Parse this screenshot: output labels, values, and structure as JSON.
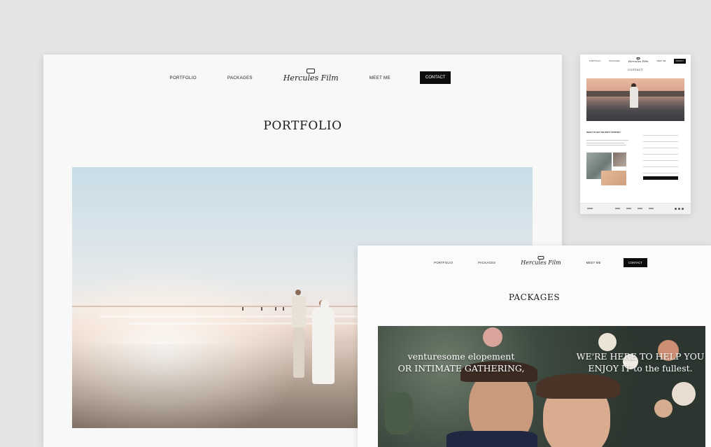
{
  "portfolio_page": {
    "nav": {
      "portfolio": "PORTFOLIO",
      "packages": "PACKAGES",
      "logo": "Hercules Film",
      "meet_me": "MEET ME",
      "contact": "CONTACT"
    },
    "title": "PORTFOLIO"
  },
  "contact_page": {
    "nav": {
      "portfolio": "PORTFOLIO",
      "packages": "PACKAGES",
      "logo": "Hercules Film",
      "meet_me": "MEET ME",
      "contact": "CONTACT"
    },
    "title": "CONTACT",
    "form_heading": "READY TO GET THE PARTY STARTED?"
  },
  "packages_page": {
    "nav": {
      "portfolio": "PORTFOLIO",
      "packages": "PACKAGES",
      "logo": "Hercules Film",
      "meet_me": "MEET ME",
      "contact": "CONTACT"
    },
    "title": "PACKAGES",
    "overlay_left_line1": "venturesome elopement",
    "overlay_left_line2": "OR INTIMATE GATHERING,",
    "overlay_right_line1": "WE'RE HERE TO HELP YOU",
    "overlay_right_line2": "ENJOY IT to the fullest."
  },
  "colors": {
    "background": "#e4e4e4",
    "panel": "#f8f8f8",
    "button": "#0c0c0c",
    "button_text": "#ffffff"
  },
  "icons": [
    "camera-logo-icon",
    "social-dot-icon"
  ]
}
